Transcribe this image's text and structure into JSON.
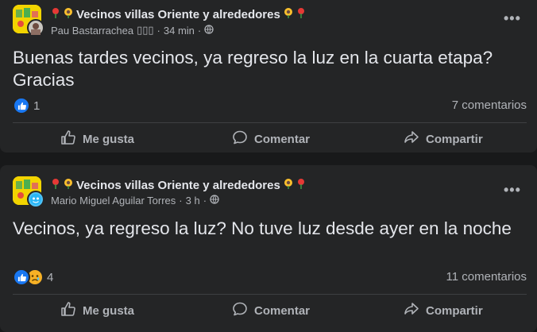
{
  "posts": [
    {
      "group_name": "Vecinos villas Oriente y alrededores",
      "author": "Pau Bastarrachea",
      "author_suffix": "▯▯▯",
      "time": "34 min",
      "text": "Buenas tardes vecinos, ya regreso la luz en la cuarta etapa? Gracias",
      "reaction_count": "1",
      "reactions": [
        "like-icon"
      ],
      "comments": "7 comentarios"
    },
    {
      "group_name": "Vecinos villas Oriente y alrededores",
      "author": "Mario Miguel Aguilar Torres",
      "author_suffix": "",
      "time": "3 h",
      "text": "Vecinos, ya regreso la luz? No tuve luz desde ayer en la noche",
      "reaction_count": "4",
      "reactions": [
        "like-icon",
        "sad-icon"
      ],
      "comments": "11 comentarios"
    }
  ],
  "actions": {
    "like": "Me gusta",
    "comment": "Comentar",
    "share": "Compartir"
  },
  "dot_separator": "·",
  "colors": {
    "background": "#18191a",
    "card": "#242526",
    "primary_text": "#e4e6eb",
    "secondary_text": "#b0b3b8",
    "like_blue": "#1877f2",
    "sad_yellow": "#f7b125"
  }
}
